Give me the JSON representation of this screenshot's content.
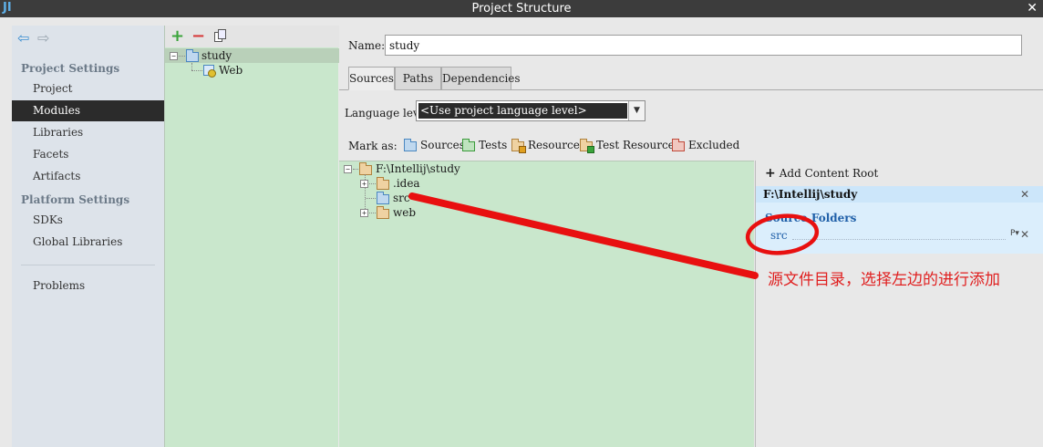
{
  "window": {
    "title": "Project Structure",
    "logo": "JI",
    "close": "✕"
  },
  "nav": {
    "back_icon": "arrow-left-icon",
    "forward_icon": "arrow-right-icon",
    "project_settings_heading": "Project Settings",
    "project_settings": [
      "Project",
      "Modules",
      "Libraries",
      "Facets",
      "Artifacts"
    ],
    "platform_settings_heading": "Platform Settings",
    "platform_settings": [
      "SDKs",
      "Global Libraries"
    ],
    "problems": "Problems",
    "selected": "Modules"
  },
  "modules": {
    "add_icon": "+",
    "remove_icon": "−",
    "tree": [
      {
        "label": "study",
        "level": 0,
        "expanded": true
      },
      {
        "label": "Web",
        "level": 1
      }
    ]
  },
  "module_settings": {
    "name_label": "Name:",
    "name_value": "study",
    "tabs": [
      "Sources",
      "Paths",
      "Dependencies"
    ],
    "active_tab": "Sources",
    "language_level_label": "Language level:",
    "language_level_value": "<Use project language level>",
    "mark_as_label": "Mark as:",
    "mark_as": [
      {
        "label": "Sources",
        "color": "blue"
      },
      {
        "label": "Tests",
        "color": "green"
      },
      {
        "label": "Resources",
        "color": "res"
      },
      {
        "label": "Test Resources",
        "color": "testres"
      },
      {
        "label": "Excluded",
        "color": "red"
      }
    ],
    "tree": {
      "root": "F:\\Intellij\\study",
      "children": [
        {
          "label": ".idea",
          "expandable": true,
          "type": "normal"
        },
        {
          "label": "src",
          "expandable": false,
          "type": "source"
        },
        {
          "label": "web",
          "expandable": true,
          "type": "normal"
        }
      ]
    },
    "content_root": {
      "add_label": "Add Content Root",
      "path": "F:\\Intellij\\study",
      "source_folders_heading": "Source Folders",
      "source_folders": [
        "src"
      ],
      "remove_icon": "✕",
      "properties_icon": "P▾"
    }
  },
  "annotation": {
    "text": "源文件目录，选择左边的进行添加",
    "color": "#e02020"
  }
}
